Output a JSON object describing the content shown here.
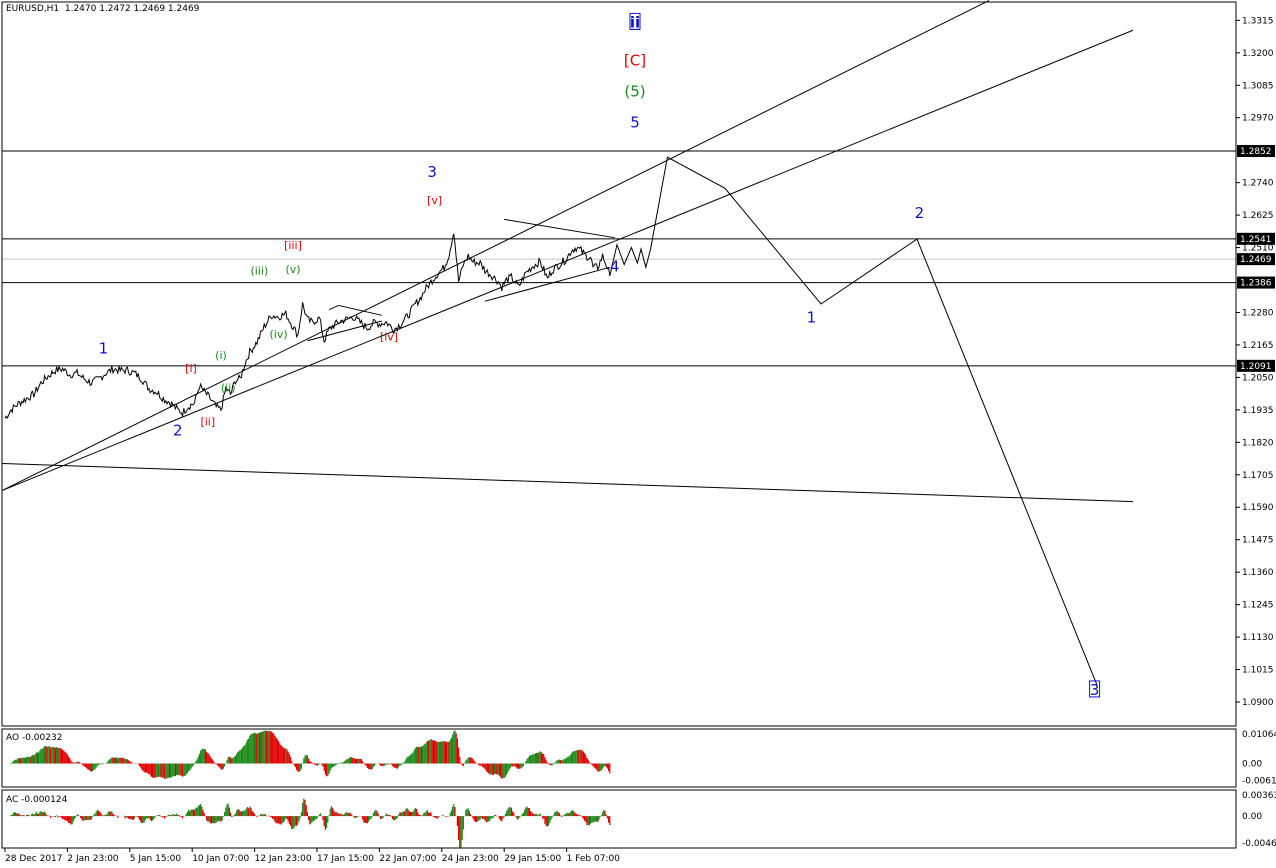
{
  "symbol_info": {
    "symbol": "EURUSD,H1",
    "ohlc": "1.2470 1.2472 1.2469 1.2469"
  },
  "colors": {
    "blue": "#1010c8",
    "red": "#e00000",
    "green": "#1a8a1a",
    "ao_up": "#1a8a1a",
    "ao_down": "#e00000",
    "grid_line": "#000000",
    "current_price": "#c8c8c8"
  },
  "chart_data": {
    "type": "line",
    "title": "EURUSD,H1",
    "price_axis": {
      "ylim": [
        1.0815,
        1.338
      ],
      "ticks": [
        "1.3315",
        "1.3200",
        "1.3085",
        "1.2970",
        "1.2740",
        "1.2625",
        "1.2510",
        "1.2280",
        "1.2165",
        "1.2050",
        "1.1935",
        "1.1820",
        "1.1705",
        "1.1590",
        "1.1475",
        "1.1360",
        "1.1245",
        "1.1130",
        "1.1015",
        "1.0900"
      ],
      "boxed_levels": [
        "1.2852",
        "1.2541",
        "1.2386",
        "1.2091"
      ],
      "current_price": "1.2469"
    },
    "time_axis": {
      "labels": [
        "28 Dec 2017",
        "2 Jan 23:00",
        "5 Jan 15:00",
        "10 Jan 07:00",
        "12 Jan 23:00",
        "17 Jan 15:00",
        "22 Jan 07:00",
        "24 Jan 23:00",
        "29 Jan 15:00",
        "1 Feb 07:00"
      ],
      "label_bars": [
        0,
        52,
        104,
        156,
        208,
        260,
        312,
        364,
        416,
        468
      ]
    },
    "price_path": [
      [
        0,
        1.1905
      ],
      [
        5,
        1.1935
      ],
      [
        12,
        1.196
      ],
      [
        18,
        1.1975
      ],
      [
        24,
        1.199
      ],
      [
        30,
        1.203
      ],
      [
        36,
        1.2055
      ],
      [
        42,
        1.2075
      ],
      [
        48,
        1.208
      ],
      [
        54,
        1.206
      ],
      [
        60,
        1.2065
      ],
      [
        66,
        1.2045
      ],
      [
        72,
        1.203
      ],
      [
        78,
        1.2045
      ],
      [
        84,
        1.2065
      ],
      [
        90,
        1.208
      ],
      [
        96,
        1.2075
      ],
      [
        102,
        1.2075
      ],
      [
        108,
        1.2065
      ],
      [
        114,
        1.2045
      ],
      [
        120,
        1.201
      ],
      [
        126,
        1.2
      ],
      [
        132,
        1.1975
      ],
      [
        138,
        1.196
      ],
      [
        144,
        1.1935
      ],
      [
        148,
        1.1925
      ],
      [
        152,
        1.1945
      ],
      [
        158,
        1.196
      ],
      [
        162,
        1.202
      ],
      [
        166,
        1.2
      ],
      [
        170,
        1.198
      ],
      [
        176,
        1.1945
      ],
      [
        180,
        1.1935
      ],
      [
        184,
        1.201
      ],
      [
        188,
        1.199
      ],
      [
        192,
        1.204
      ],
      [
        196,
        1.2045
      ],
      [
        200,
        1.21
      ],
      [
        204,
        1.214
      ],
      [
        210,
        1.2175
      ],
      [
        216,
        1.223
      ],
      [
        222,
        1.227
      ],
      [
        228,
        1.2265
      ],
      [
        234,
        1.2275
      ],
      [
        240,
        1.223
      ],
      [
        244,
        1.22
      ],
      [
        248,
        1.231
      ],
      [
        252,
        1.2255
      ],
      [
        256,
        1.2245
      ],
      [
        262,
        1.226
      ],
      [
        266,
        1.218
      ],
      [
        270,
        1.222
      ],
      [
        274,
        1.2235
      ],
      [
        280,
        1.225
      ],
      [
        284,
        1.2255
      ],
      [
        290,
        1.2265
      ],
      [
        296,
        1.2245
      ],
      [
        302,
        1.2225
      ],
      [
        308,
        1.2245
      ],
      [
        312,
        1.224
      ],
      [
        318,
        1.2245
      ],
      [
        324,
        1.222
      ],
      [
        330,
        1.224
      ],
      [
        336,
        1.227
      ],
      [
        342,
        1.231
      ],
      [
        346,
        1.233
      ],
      [
        350,
        1.236
      ],
      [
        356,
        1.2395
      ],
      [
        360,
        1.2415
      ],
      [
        366,
        1.244
      ],
      [
        370,
        1.2485
      ],
      [
        374,
        1.257
      ],
      [
        378,
        1.239
      ],
      [
        382,
        1.245
      ],
      [
        386,
        1.248
      ],
      [
        390,
        1.246
      ],
      [
        396,
        1.2455
      ],
      [
        400,
        1.243
      ],
      [
        406,
        1.241
      ],
      [
        410,
        1.2395
      ],
      [
        414,
        1.237
      ],
      [
        418,
        1.2395
      ],
      [
        422,
        1.2405
      ],
      [
        428,
        1.237
      ],
      [
        434,
        1.242
      ],
      [
        440,
        1.2445
      ],
      [
        446,
        1.246
      ],
      [
        452,
        1.24
      ],
      [
        456,
        1.243
      ],
      [
        462,
        1.245
      ],
      [
        468,
        1.247
      ],
      [
        472,
        1.25
      ],
      [
        476,
        1.251
      ],
      [
        480,
        1.25
      ],
      [
        484,
        1.248
      ],
      [
        488,
        1.2475
      ],
      [
        490,
        1.244
      ],
      [
        494,
        1.244
      ],
      [
        498,
        1.248
      ],
      [
        502,
        1.244
      ],
      [
        504,
        1.241
      ]
    ],
    "forecast_path": [
      [
        504,
        1.241
      ],
      [
        510,
        1.252
      ],
      [
        516,
        1.245
      ],
      [
        522,
        1.251
      ],
      [
        527,
        1.2455
      ],
      [
        530,
        1.2505
      ],
      [
        534,
        1.244
      ],
      [
        538,
        1.2505
      ],
      [
        552,
        1.283
      ],
      [
        600,
        1.272
      ],
      [
        680,
        1.231
      ],
      [
        760,
        1.254
      ],
      [
        910,
        1.096
      ]
    ],
    "price_axis_note": "values in price units",
    "trend_lines": [
      {
        "points": [
          [
            -2,
            1.165
          ],
          [
            820,
            1.3385
          ]
        ]
      },
      {
        "points": [
          [
            -2,
            1.165
          ],
          [
            940,
            1.328
          ]
        ]
      },
      {
        "points": [
          [
            -2,
            1.1745
          ],
          [
            940,
            1.161
          ]
        ]
      },
      {
        "points": [
          [
            416,
            1.261
          ],
          [
            508,
            1.2545
          ]
        ]
      },
      {
        "points": [
          [
            400,
            1.232
          ],
          [
            504,
            1.244
          ]
        ]
      },
      {
        "points": [
          [
            252,
            1.218
          ],
          [
            314,
            1.225
          ]
        ]
      },
      {
        "points": [
          [
            278,
            1.2305
          ],
          [
            314,
            1.227
          ]
        ]
      },
      {
        "points": [
          [
            270,
            1.229
          ],
          [
            278,
            1.2305
          ]
        ]
      }
    ],
    "wave_labels": [
      {
        "text": "ii",
        "color": "blue",
        "bar": 525,
        "price": 1.329,
        "boxed": true,
        "underline": true
      },
      {
        "text": "[C]",
        "color": "red",
        "bar": 525,
        "price": 1.3155
      },
      {
        "text": "(5)",
        "color": "green",
        "bar": 525,
        "price": 1.3045
      },
      {
        "text": "5",
        "color": "blue",
        "bar": 525,
        "price": 1.2935
      },
      {
        "text": "3",
        "color": "blue",
        "bar": 356,
        "price": 1.276
      },
      {
        "text": "[v]",
        "color": "red",
        "bar": 358,
        "price": 1.2665
      },
      {
        "text": "[iii]",
        "color": "red",
        "bar": 240,
        "price": 1.2505
      },
      {
        "text": "(v)",
        "color": "green",
        "bar": 240,
        "price": 1.242
      },
      {
        "text": "(iii)",
        "color": "green",
        "bar": 212,
        "price": 1.2415
      },
      {
        "text": "(iv)",
        "color": "green",
        "bar": 228,
        "price": 1.219
      },
      {
        "text": "(i)",
        "color": "green",
        "bar": 180,
        "price": 1.2115
      },
      {
        "text": "(ii)",
        "color": "green",
        "bar": 186,
        "price": 1.2
      },
      {
        "text": "[i]",
        "color": "red",
        "bar": 155,
        "price": 1.207
      },
      {
        "text": "[ii]",
        "color": "red",
        "bar": 169,
        "price": 1.188
      },
      {
        "text": "[iv]",
        "color": "red",
        "bar": 320,
        "price": 1.218
      },
      {
        "text": "4",
        "color": "blue",
        "bar": 508,
        "price": 1.2425
      },
      {
        "text": "1",
        "color": "blue",
        "bar": 82,
        "price": 1.2135
      },
      {
        "text": "2",
        "color": "blue",
        "bar": 144,
        "price": 1.1845
      },
      {
        "text": "1",
        "color": "blue",
        "bar": 672,
        "price": 1.2245
      },
      {
        "text": "2",
        "color": "blue",
        "bar": 762,
        "price": 1.2615
      },
      {
        "text": "3",
        "color": "blue",
        "bar": 908,
        "price": 1.0925,
        "boxed": true
      }
    ],
    "ao": {
      "label": "AO -0.00232",
      "ticks": [
        "0.01064",
        "0.00",
        "-0.00612"
      ],
      "ylim": [
        -0.0085,
        0.0125
      ]
    },
    "ac": {
      "label": "AC -0.000124",
      "ticks": [
        "0.003631",
        "0.00",
        "-0.00465"
      ],
      "ylim": [
        -0.0055,
        0.0045
      ]
    }
  }
}
